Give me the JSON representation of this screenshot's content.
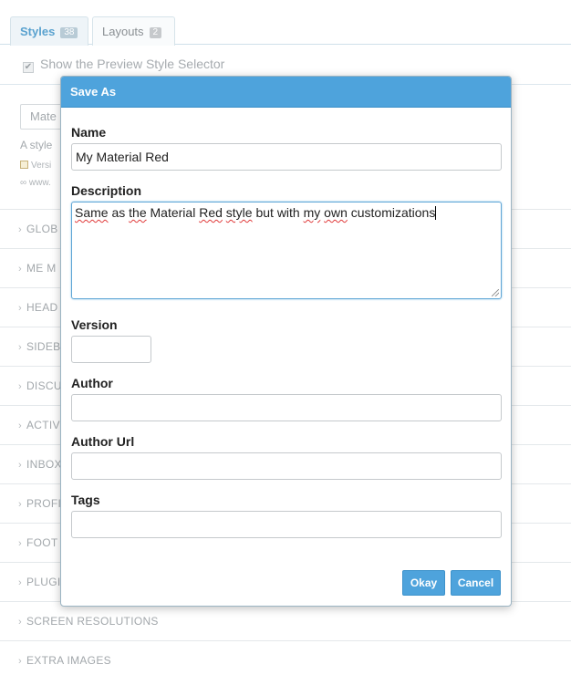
{
  "tabs": [
    {
      "label": "Styles",
      "count": "38"
    },
    {
      "label": "Layouts",
      "count": "2"
    }
  ],
  "background": {
    "preview_selector_label": "Show the Preview Style Selector",
    "style_select_value": "Mate",
    "description_fragment": "A style",
    "version_fragment": "Versi",
    "url_fragment": "www.",
    "sections": [
      "GLOB",
      "ME M",
      "HEAD",
      "SIDEB",
      "DISCU",
      "ACTIV",
      "INBOX",
      "PROFI",
      "FOOT",
      "PLUGI",
      "SCREEN RESOLUTIONS",
      "EXTRA IMAGES"
    ]
  },
  "dialog": {
    "title": "Save As",
    "name_label": "Name",
    "name_value": "My Material Red",
    "description_label": "Description",
    "description_words": [
      "Same",
      " as ",
      "the",
      " Material ",
      "Red",
      " ",
      "style",
      " but with ",
      "my",
      " ",
      "own",
      " customizations"
    ],
    "version_label": "Version",
    "version_value": "",
    "author_label": "Author",
    "author_value": "",
    "author_url_label": "Author Url",
    "author_url_value": "",
    "tags_label": "Tags",
    "tags_value": "",
    "okay_label": "Okay",
    "cancel_label": "Cancel"
  },
  "colors": {
    "accent": "#4ea3dc",
    "header_text": "#ffffff",
    "spellcheck": "#e03a3a"
  }
}
